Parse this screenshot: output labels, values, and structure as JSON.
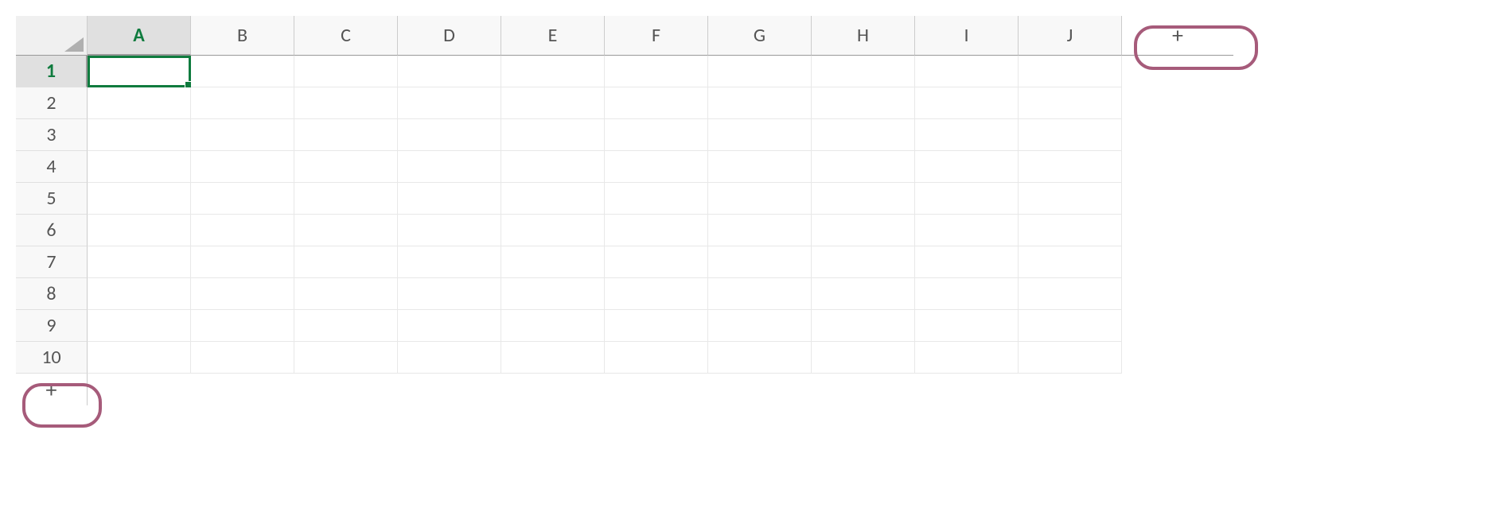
{
  "columns": [
    "A",
    "B",
    "C",
    "D",
    "E",
    "F",
    "G",
    "H",
    "I",
    "J"
  ],
  "rows": [
    "1",
    "2",
    "3",
    "4",
    "5",
    "6",
    "7",
    "8",
    "9",
    "10"
  ],
  "selected_cell": "A1",
  "selected_column": "A",
  "selected_row": "1",
  "add_column_label": "+",
  "add_row_label": "+",
  "cells": {}
}
